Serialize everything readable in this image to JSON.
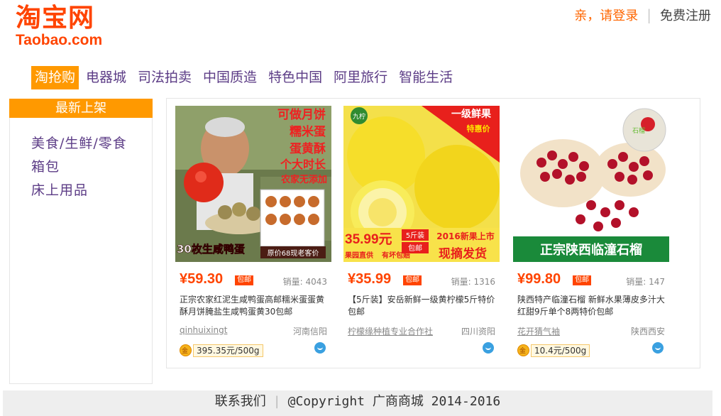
{
  "logo": {
    "cn": "淘宝网",
    "en": "Taobao.com"
  },
  "top_links": {
    "login": "亲，请登录",
    "register": "免费注册"
  },
  "nav": [
    "淘抢购",
    "电器城",
    "司法拍卖",
    "中国质造",
    "特色中国",
    "阿里旅行",
    "智能生活"
  ],
  "sidebar": {
    "title": "最新上架",
    "items": [
      "美食/生鲜/零食",
      "箱包",
      "床上用品"
    ]
  },
  "products": [
    {
      "banner": {
        "t1": "可做月饼",
        "t2": "糯米蛋",
        "t3": "蛋黄酥",
        "t4": "个大时长",
        "t5": "农家无添加",
        "count": "30枚生咸鸭蛋",
        "note": "原价68现老客价"
      },
      "price": "¥59.30",
      "baoyou": "包邮",
      "sales": "销量: 4043",
      "title": "正宗农家红泥生咸鸭蛋高邮糯米蛋蛋黄酥月饼腌盐生咸鸭蛋黄30包邮",
      "shop": "qinhuixingt",
      "loc": "河南信阳",
      "unit": "395.35元/500g"
    },
    {
      "banner": {
        "brand": "九柠",
        "t1": "一级鲜果",
        "t2": "特惠价",
        "price": "35.99元",
        "weight": "5斤装",
        "baoyou": "包邮",
        "new": "2016新果上市",
        "tag1": "果园直供",
        "tag2": "有坏包赔",
        "tag3": "现摘发货"
      },
      "price": "¥35.99",
      "baoyou": "包邮",
      "sales": "销量: 1316",
      "title": "【5斤装】安岳新鲜一级黄柠檬5斤特价包邮",
      "shop": "柠檬缘种植专业合作社",
      "loc": "四川资阳",
      "unit": ""
    },
    {
      "banner": {
        "badge": "石榴",
        "bottom": "正宗陕西临潼石榴"
      },
      "price": "¥99.80",
      "baoyou": "包邮",
      "sales": "销量: 147",
      "title": "陕西特产临潼石榴 新鲜水果薄皮多汁大红甜9斤单个8两特价包邮",
      "shop": "花开猜气袖",
      "loc": "陕西西安",
      "unit": "10.4元/500g"
    }
  ],
  "footer": {
    "contact": "联系我们",
    "copyright": "@Copyright 广商商城  2014-2016"
  },
  "colors": {
    "brand": "#ff4400",
    "nav_active": "#ff9900",
    "link": "#5c3c86"
  }
}
